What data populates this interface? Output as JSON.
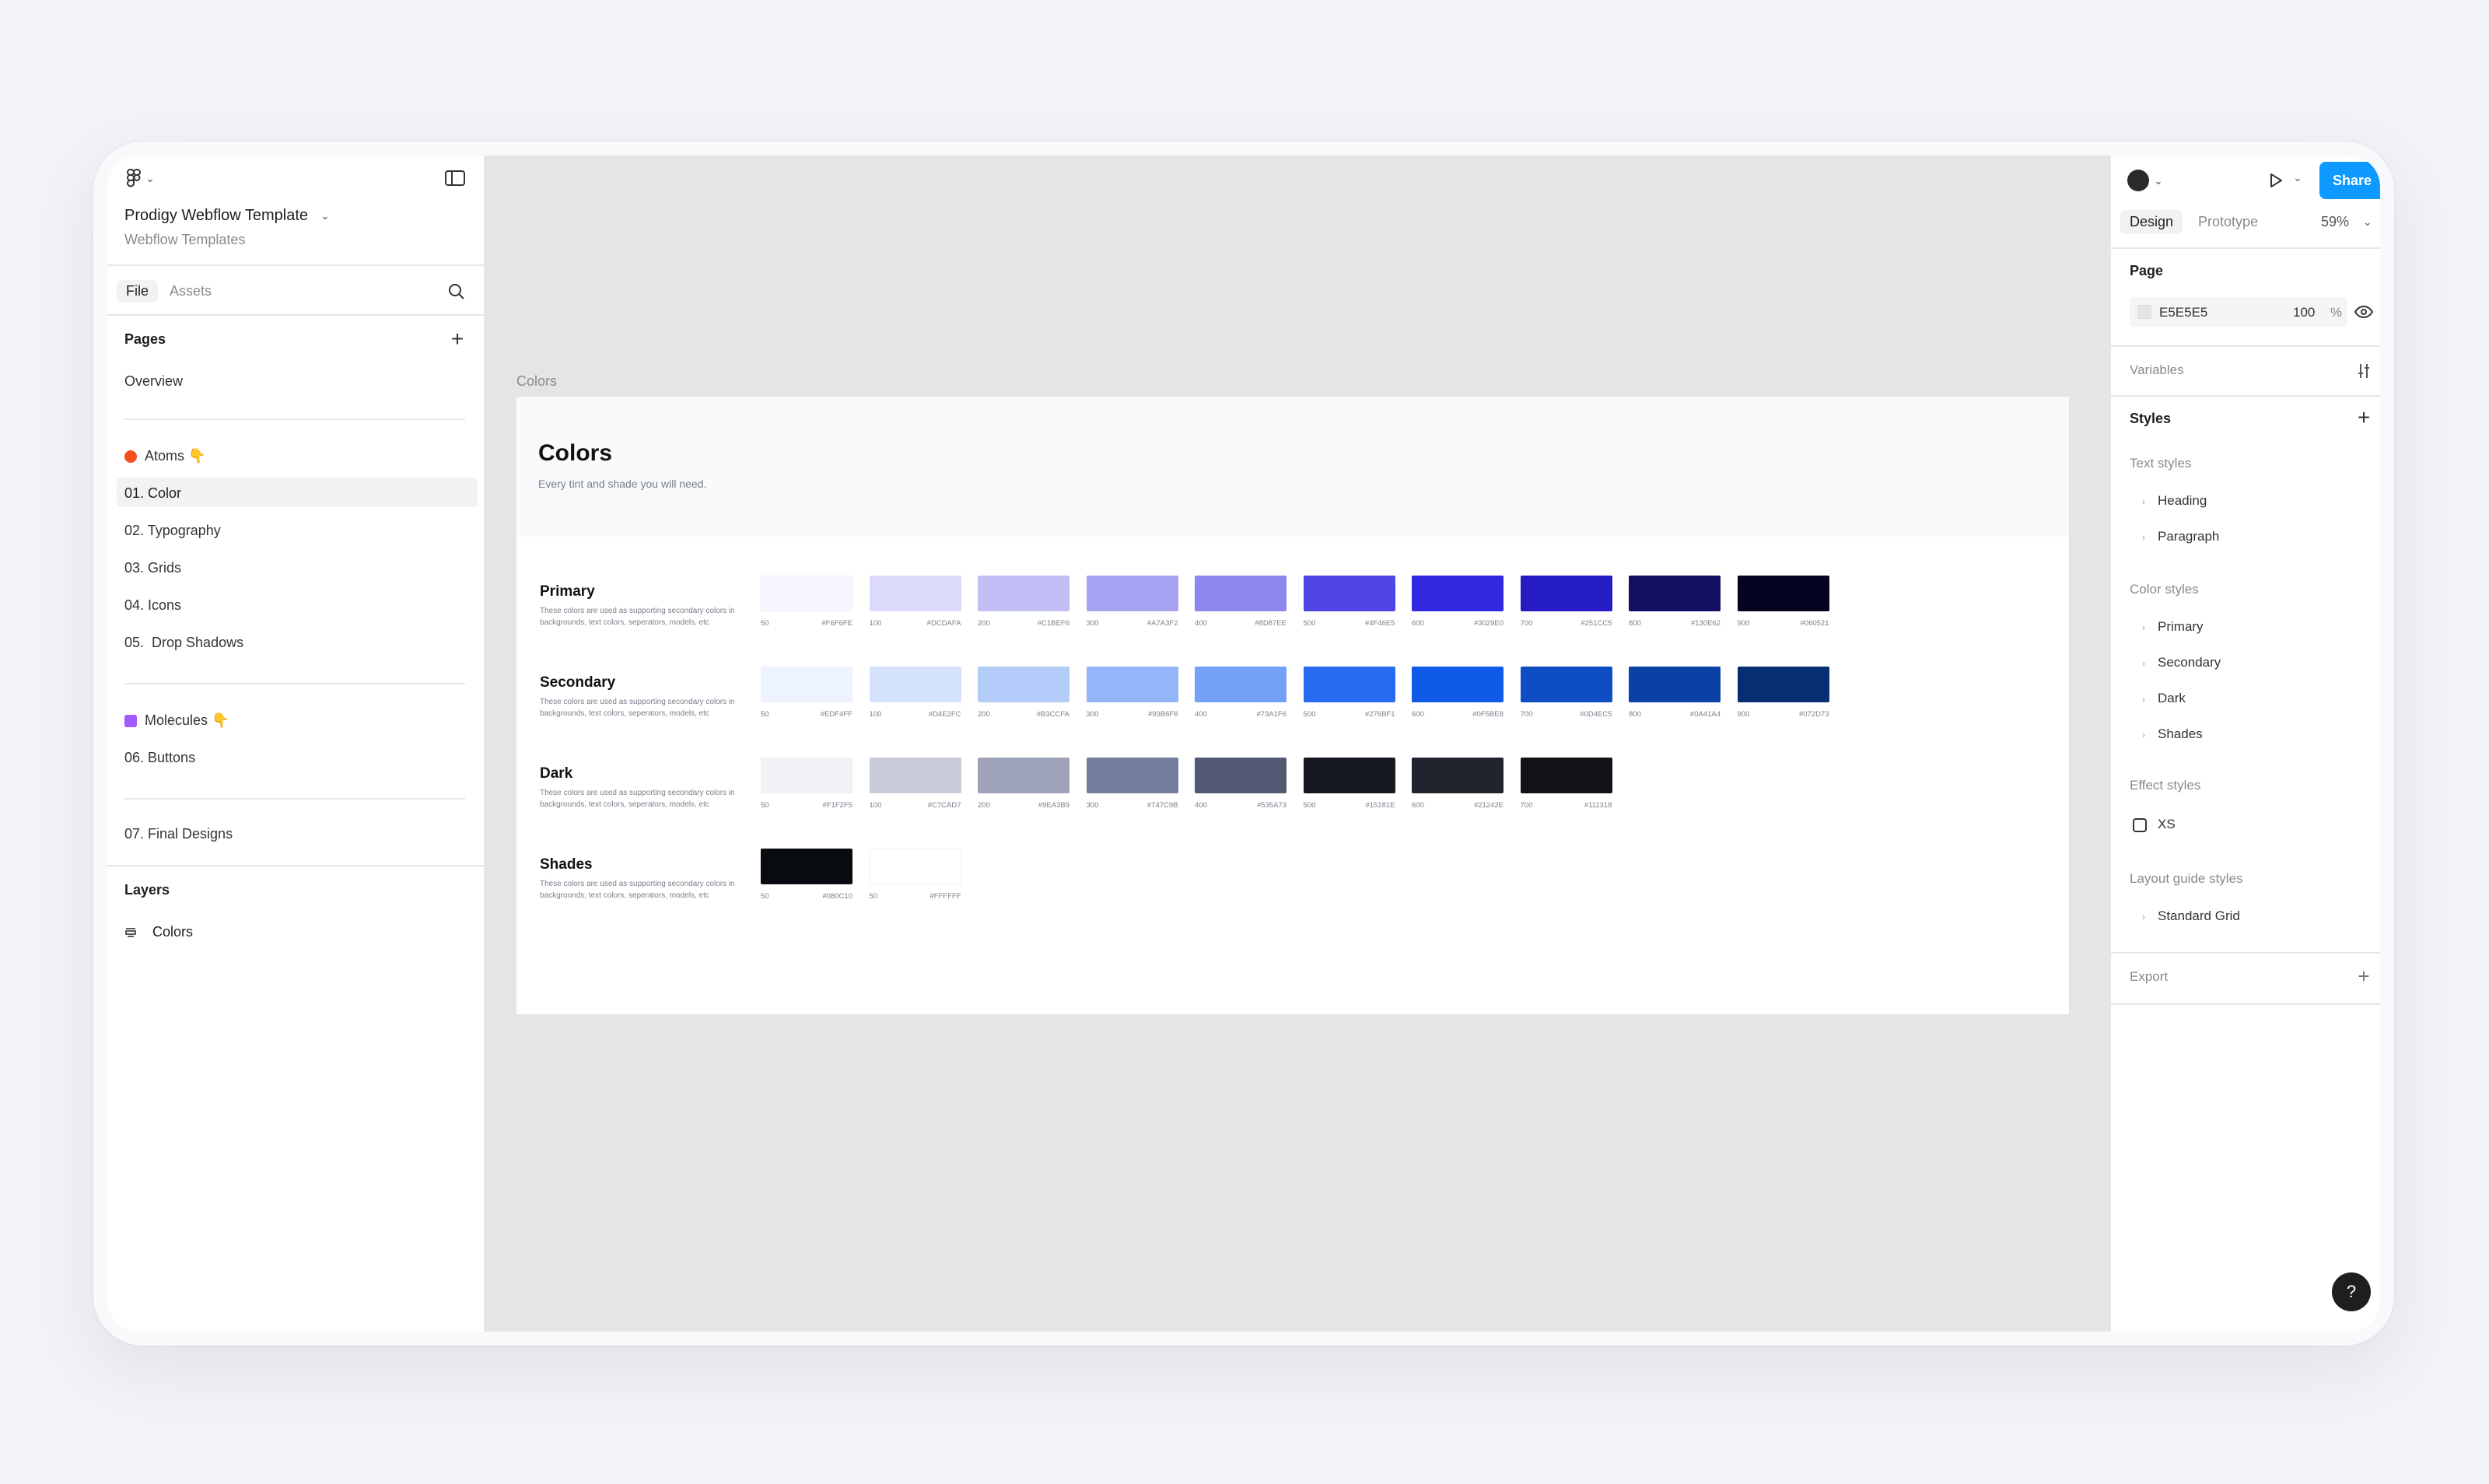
{
  "file": {
    "title": "Prodigy Webflow Template",
    "team": "Webflow Templates"
  },
  "left_panel": {
    "tabs": [
      "File",
      "Assets"
    ],
    "pages_heading": "Pages",
    "pages": [
      {
        "label": "Overview",
        "icon": ""
      },
      {
        "label": "Atoms 👇",
        "icon": "red-dot"
      },
      {
        "label": "01. Color",
        "icon": "",
        "selected": true
      },
      {
        "label": "02. Typography",
        "icon": ""
      },
      {
        "label": "03. Grids",
        "icon": ""
      },
      {
        "label": "04. Icons",
        "icon": ""
      },
      {
        "label": "05.  Drop Shadows",
        "icon": ""
      },
      {
        "label": "Molecules 👇",
        "icon": "purple-square"
      },
      {
        "label": "06. Buttons",
        "icon": ""
      },
      {
        "label": "07. Final Designs",
        "icon": ""
      }
    ],
    "layers_heading": "Layers",
    "layers": [
      {
        "label": "Colors",
        "icon": "frame-icon"
      }
    ]
  },
  "canvas": {
    "frame_label": "Colors",
    "frame_title": "Colors",
    "frame_subtitle": "Every tint and shade you will need.",
    "groups": [
      {
        "name": "Primary",
        "desc": "These colors are used as supporting secondary colors in backgrounds, text colors, seperators, models, etc",
        "swatches": [
          {
            "step": "50",
            "hex": "#F6F6FE"
          },
          {
            "step": "100",
            "hex": "#DCDAFA"
          },
          {
            "step": "200",
            "hex": "#C1BEF6"
          },
          {
            "step": "300",
            "hex": "#A7A3F2"
          },
          {
            "step": "400",
            "hex": "#8D87EE"
          },
          {
            "step": "500",
            "hex": "#4F46E5"
          },
          {
            "step": "600",
            "hex": "#3029E0"
          },
          {
            "step": "700",
            "hex": "#251CC5"
          },
          {
            "step": "800",
            "hex": "#130E62"
          },
          {
            "step": "900",
            "hex": "#060521"
          }
        ]
      },
      {
        "name": "Secondary",
        "desc": "These colors are used as supporting secondary colors in backgrounds, text colors, seperators, models, etc",
        "swatches": [
          {
            "step": "50",
            "hex": "#EDF4FF"
          },
          {
            "step": "100",
            "hex": "#D4E2FC"
          },
          {
            "step": "200",
            "hex": "#B3CCFA"
          },
          {
            "step": "300",
            "hex": "#93B6F8"
          },
          {
            "step": "400",
            "hex": "#73A1F6"
          },
          {
            "step": "500",
            "hex": "#276BF1"
          },
          {
            "step": "600",
            "hex": "#0F5BE8"
          },
          {
            "step": "700",
            "hex": "#0D4EC5"
          },
          {
            "step": "800",
            "hex": "#0A41A4"
          },
          {
            "step": "900",
            "hex": "#072D73"
          }
        ]
      },
      {
        "name": "Dark",
        "desc": "These colors are used as supporting secondary colors in backgrounds, text colors, seperators, models, etc",
        "swatches": [
          {
            "step": "50",
            "hex": "#F1F2F5"
          },
          {
            "step": "100",
            "hex": "#C7CAD7"
          },
          {
            "step": "200",
            "hex": "#9EA3B9"
          },
          {
            "step": "300",
            "hex": "#747C9B"
          },
          {
            "step": "400",
            "hex": "#535A73"
          },
          {
            "step": "500",
            "hex": "#15181E"
          },
          {
            "step": "600",
            "hex": "#21242E"
          },
          {
            "step": "700",
            "hex": "#111318"
          }
        ]
      },
      {
        "name": "Shades",
        "desc": "These colors are used as supporting secondary colors in backgrounds, text colors, seperators, models, etc",
        "swatches": [
          {
            "step": "50",
            "hex": "#080C10"
          },
          {
            "step": "50",
            "hex": "#FFFFFF"
          }
        ]
      }
    ]
  },
  "toolbar": {
    "tools": [
      "move-icon",
      "frame-icon",
      "rectangle-icon",
      "pen-icon",
      "text-icon",
      "comment-icon",
      "components-icon",
      "draw-icon",
      "dev-mode-icon",
      "code-icon"
    ]
  },
  "right_panel": {
    "share_label": "Share",
    "tabs": [
      "Design",
      "Prototype"
    ],
    "zoom": "59%",
    "page_heading": "Page",
    "page_color": "E5E5E5",
    "page_opacity": "100",
    "page_opacity_unit": "%",
    "variables_label": "Variables",
    "styles_heading": "Styles",
    "text_styles_label": "Text styles",
    "text_styles": [
      "Heading",
      "Paragraph"
    ],
    "color_styles_label": "Color styles",
    "color_styles": [
      "Primary",
      "Secondary",
      "Dark",
      "Shades"
    ],
    "effect_styles_label": "Effect styles",
    "effect_styles": [
      "XS"
    ],
    "layout_styles_label": "Layout guide styles",
    "layout_styles": [
      "Standard Grid"
    ],
    "export_label": "Export",
    "help_label": "?"
  },
  "colors": {
    "accent": "#0d99ff",
    "selected_row": "#f2f2f2"
  }
}
